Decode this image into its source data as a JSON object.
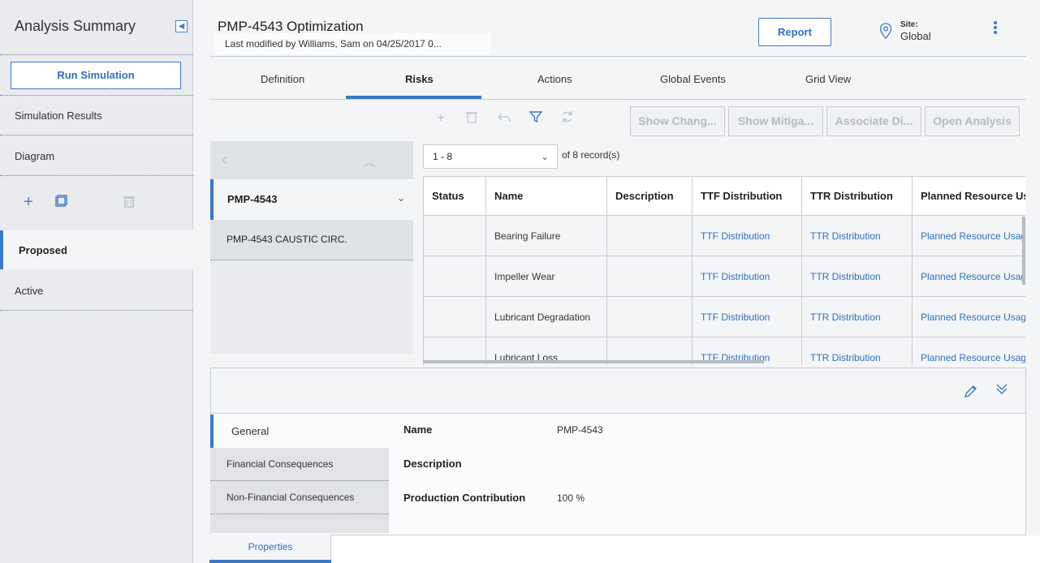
{
  "sidebar": {
    "title": "Analysis Summary",
    "run_simulation": "Run Simulation",
    "items": [
      {
        "label": "Simulation Results"
      },
      {
        "label": "Diagram"
      },
      {
        "label": "Proposed"
      },
      {
        "label": "Active"
      }
    ],
    "tools": {
      "add": "+",
      "copy": "copy-icon",
      "delete": "trash-icon"
    }
  },
  "header": {
    "title": "PMP-4543 Optimization",
    "last_modified": "Last modified by Williams, Sam on 04/25/2017 0...",
    "report": "Report",
    "site_label": "Site:",
    "site_value": "Global"
  },
  "tabs": [
    {
      "label": "Definition"
    },
    {
      "label": "Risks"
    },
    {
      "label": "Actions"
    },
    {
      "label": "Global Events"
    },
    {
      "label": "Grid View"
    }
  ],
  "toolbar": {
    "buttons": [
      {
        "label": "Show Chang..."
      },
      {
        "label": "Show Mitiga..."
      },
      {
        "label": "Associate Di..."
      },
      {
        "label": "Open Analysis"
      }
    ]
  },
  "record_list": {
    "selected": "PMP-4543",
    "child": "PMP-4543 CAUSTIC CIRC."
  },
  "grid": {
    "page_range": "1 - 8",
    "of_label": "of",
    "total": "8",
    "records_label": "record(s)",
    "columns": [
      "Status",
      "Name",
      "Description",
      "TTF Distribution",
      "TTR Distribution",
      "Planned Resource Usa"
    ],
    "rows": [
      {
        "status": "",
        "name": "Bearing Failure",
        "description": "",
        "ttf": "TTF Distribution",
        "ttr": "TTR Distribution",
        "resource": "Planned Resource Usag"
      },
      {
        "status": "",
        "name": "Impeller Wear",
        "description": "",
        "ttf": "TTF Distribution",
        "ttr": "TTR Distribution",
        "resource": "Planned Resource Usag"
      },
      {
        "status": "",
        "name": "Lubricant Degradation",
        "description": "",
        "ttf": "TTF Distribution",
        "ttr": "TTR Distribution",
        "resource": "Planned Resource Usag"
      },
      {
        "status": "",
        "name": "Lubricant Loss",
        "description": "",
        "ttf": "TTF Distribution",
        "ttr": "TTR Distribution",
        "resource": "Planned Resource Usag"
      }
    ]
  },
  "details": {
    "sections": [
      {
        "label": "General"
      },
      {
        "label": "Financial Consequences"
      },
      {
        "label": "Non-Financial Consequences"
      }
    ],
    "fields": [
      {
        "label": "Name",
        "value": "PMP-4543"
      },
      {
        "label": "Description",
        "value": ""
      },
      {
        "label": "Production Contribution",
        "value": "100 %"
      }
    ],
    "bottom_tab": "Properties"
  },
  "colors": {
    "accent": "#3d78c4",
    "link": "#2f6fbe"
  }
}
